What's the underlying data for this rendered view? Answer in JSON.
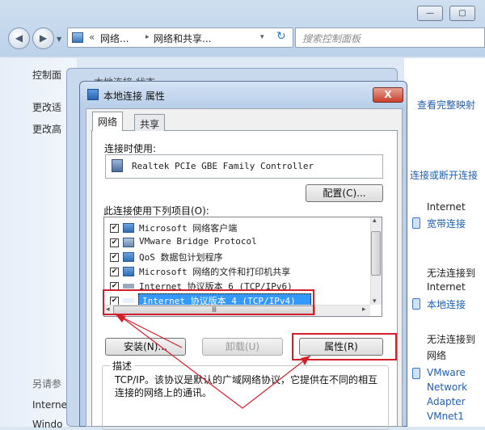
{
  "explorer": {
    "breadcrumb_prefix": "«",
    "breadcrumb_1": "网络...",
    "breadcrumb_2": "网络和共享...",
    "search_placeholder": "搜索控制面板",
    "left_pane": [
      "控制面",
      "更改适",
      "更改高",
      "另请参",
      "Interne",
      "Windo"
    ],
    "right_pane": {
      "full_map_link": "查看完整映射",
      "connect_link": "连接或断开连接",
      "net1_status": "Internet",
      "net1_link": "宽带连接",
      "net2_status_1": "无法连接到",
      "net2_status_2": "Internet",
      "net2_link": "本地连接",
      "net3_status_1": "无法连接到",
      "net3_status_2": "网络",
      "net3_link_1": "VMware",
      "net3_link_2": "Network",
      "net3_link_3": "Adapter",
      "net3_link_4": "VMnet1"
    }
  },
  "behind_dialog": {
    "title": "本地连接 状态"
  },
  "dialog": {
    "title": "本地连接 属性",
    "close": "X",
    "tabs": [
      "网络",
      "共享"
    ],
    "connect_using_label": "连接时使用:",
    "adapter_name": "Realtek PCIe GBE Family Controller",
    "configure_button": "配置(C)...",
    "items_label": "此连接使用下列项目(O):",
    "items": [
      {
        "label": "Microsoft 网络客户端",
        "checked": true
      },
      {
        "label": "VMware Bridge Protocol",
        "checked": true
      },
      {
        "label": "QoS 数据包计划程序",
        "checked": true
      },
      {
        "label": "Microsoft 网络的文件和打印机共享",
        "checked": true
      },
      {
        "label": "Internet 协议版本 6 (TCP/IPv6)",
        "checked": true
      },
      {
        "label": "Internet 协议版本 4 (TCP/IPv4)",
        "checked": true,
        "selected": true
      }
    ],
    "install_button": "安装(N)...",
    "uninstall_button": "卸载(U)",
    "properties_button": "属性(R)",
    "description_label": "描述",
    "description_text": "TCP/IP。该协议是默认的广域网络协议，它提供在不同的相互连接的网络上的通讯。",
    "check_mark": "✔",
    "scroll_left": "◂",
    "scroll_right": "▸",
    "scroll_up": "▴",
    "scroll_down": "▾",
    "scroll_grip": "Ⅲ"
  },
  "window_controls": {
    "minimize": "—",
    "maximize": "▢",
    "close": "✕"
  },
  "colors": {
    "highlight": "#3399ff",
    "annotation_red": "#d4202a",
    "link_blue": "#1e5fb4"
  }
}
